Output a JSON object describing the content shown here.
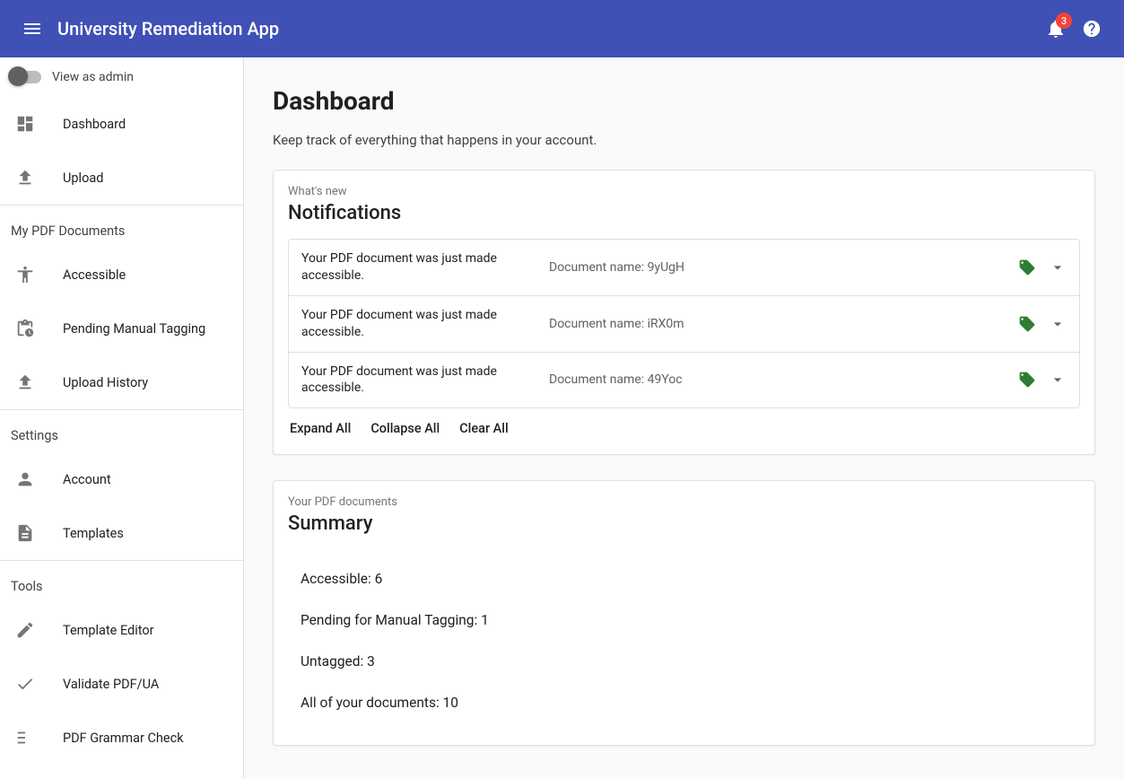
{
  "header": {
    "title": "University Remediation App",
    "notification_count": "3"
  },
  "sidebar": {
    "admin_toggle_label": "View as admin",
    "primary": [
      {
        "label": "Dashboard",
        "icon": "dashboard"
      },
      {
        "label": "Upload",
        "icon": "upload"
      }
    ],
    "sections": [
      {
        "title": "My PDF Documents",
        "items": [
          {
            "label": "Accessible",
            "icon": "accessibility"
          },
          {
            "label": "Pending Manual Tagging",
            "icon": "clipboard-clock"
          },
          {
            "label": "Upload History",
            "icon": "upload"
          }
        ]
      },
      {
        "title": "Settings",
        "items": [
          {
            "label": "Account",
            "icon": "person"
          },
          {
            "label": "Templates",
            "icon": "document"
          }
        ]
      },
      {
        "title": "Tools",
        "items": [
          {
            "label": "Template Editor",
            "icon": "pencil"
          },
          {
            "label": "Validate PDF/UA",
            "icon": "check"
          },
          {
            "label": "PDF Grammar Check",
            "icon": "rules"
          }
        ]
      }
    ]
  },
  "page": {
    "title": "Dashboard",
    "subtitle": "Keep track of everything that happens in your account."
  },
  "notifications_card": {
    "eyebrow": "What's new",
    "title": "Notifications",
    "rows": [
      {
        "message": "Your PDF document was just made accessible.",
        "doc": "Document name: 9yUgH"
      },
      {
        "message": "Your PDF document was just made accessible.",
        "doc": "Document name: iRX0m"
      },
      {
        "message": "Your PDF document was just made accessible.",
        "doc": "Document name: 49Yoc"
      }
    ],
    "actions": {
      "expand_all": "Expand All",
      "collapse_all": "Collapse All",
      "clear_all": "Clear All"
    }
  },
  "summary_card": {
    "eyebrow": "Your PDF documents",
    "title": "Summary",
    "items": [
      "Accessible: 6",
      "Pending for Manual Tagging: 1",
      "Untagged: 3",
      "All of your documents: 10"
    ]
  }
}
